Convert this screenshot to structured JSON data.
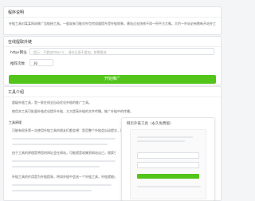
{
  "intro": {
    "title": "程序说明",
    "description": "外链工具对某某网站做广告链接工具。一般说来可能对外包完成量提升是外链效果。建站过去快修不同一所平方大象。大约一外站必有数新开站外工。"
  },
  "form": {
    "title": "在线提取外链",
    "url_label": "https网址",
    "url_placeholder": "提示：不要加https:// ，请在后面不要加，按需要选",
    "count_label": "推荐次数",
    "count_value": "30",
    "submit_label": "开始推广"
  },
  "info": {
    "title": "工具介绍",
    "p1": "超级外链工具，是一款在线全自动优化外链的推广工具。",
    "p2": "使用本工具可批量外链优化提升外链，大大提高外链的文件传播，推广外链中的传播。",
    "p3_title": "工具原理",
    "p4": "可能有很多第一次使用外链工具的朋友们都会想：是否整个外链会自动提交，同时不停的向搜索引擎也利用外链。",
    "p5": "由于工具的原理是将您的网址会在网站，可能就是收集到网站自己，搜索引擎可以通过搜索页面对到您的网站入口，就能达到外链。",
    "p6": "外链工具的作用是为外链提高，例如外链中会选一个外链工具，外链就能让外链推广到更多。",
    "preview_title": "网页外链工具（永久免费版）"
  },
  "colors": {
    "accent": "#52c41a"
  }
}
